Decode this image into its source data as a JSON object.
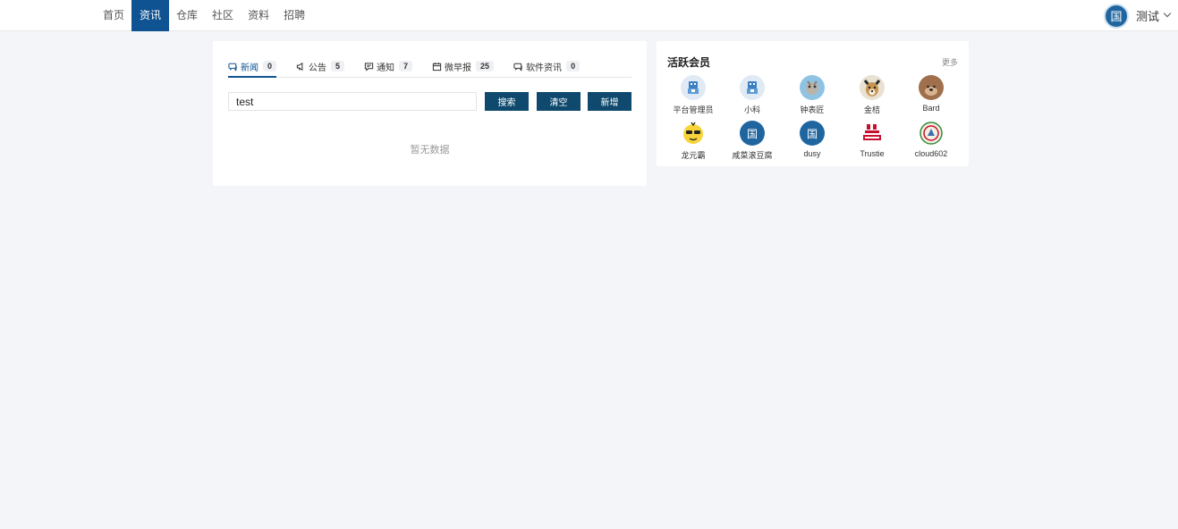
{
  "nav": {
    "items": [
      {
        "label": "首页",
        "active": false
      },
      {
        "label": "资讯",
        "active": true
      },
      {
        "label": "仓库",
        "active": false
      },
      {
        "label": "社区",
        "active": false
      },
      {
        "label": "资料",
        "active": false
      },
      {
        "label": "招聘",
        "active": false
      }
    ]
  },
  "user": {
    "avatar_text": "国",
    "name": "测试",
    "menu_icon": "chevron-down-icon"
  },
  "tabs": [
    {
      "label": "新闻",
      "count": "0",
      "icon": "chat-bubble-icon",
      "active": true
    },
    {
      "label": "公告",
      "count": "5",
      "icon": "megaphone-icon",
      "active": false
    },
    {
      "label": "通知",
      "count": "7",
      "icon": "message-icon",
      "active": false
    },
    {
      "label": "微早报",
      "count": "25",
      "icon": "calendar-icon",
      "active": false
    },
    {
      "label": "软件资讯",
      "count": "0",
      "icon": "chat-bubble-icon",
      "active": false
    }
  ],
  "search": {
    "value": "test",
    "search_label": "搜索",
    "clear_label": "清空",
    "add_label": "新增"
  },
  "empty_text": "暂无数据",
  "members_panel": {
    "title": "活跃会员",
    "more": "更多",
    "members": [
      {
        "name": "平台管理员",
        "avatar": "robot-avatar"
      },
      {
        "name": "小科",
        "avatar": "robot-avatar"
      },
      {
        "name": "钟表匠",
        "avatar": "cartoon-avatar"
      },
      {
        "name": "金桔",
        "avatar": "dog-avatar"
      },
      {
        "name": "Bard",
        "avatar": "bear-avatar"
      },
      {
        "name": "龙元霸",
        "avatar": "emoji-avatar"
      },
      {
        "name": "咸菜滚豆腐",
        "avatar": "国"
      },
      {
        "name": "dusy",
        "avatar": "国"
      },
      {
        "name": "Trustie",
        "avatar": "trustie-logo-avatar"
      },
      {
        "name": "cloud602",
        "avatar": "emblem-avatar"
      }
    ]
  },
  "colors": {
    "primary": "#0f5392",
    "button": "#0f4a6e",
    "avatar_blue": "#1f66a0",
    "background": "#f4f5f9"
  }
}
